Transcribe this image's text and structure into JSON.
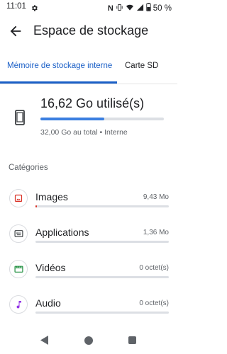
{
  "status_bar": {
    "time": "11:01",
    "battery_percent": "50 %",
    "nfc_letter": "N",
    "icons": [
      "gear-icon",
      "nfc-icon",
      "vibrate-icon",
      "wifi-icon",
      "signal-icon",
      "battery-icon"
    ]
  },
  "header": {
    "title": "Espace de stockage",
    "back_icon": "arrow-back-icon"
  },
  "tabs": [
    {
      "label": "Mémoire de stockage interne",
      "selected": true
    },
    {
      "label": "Carte SD",
      "selected": false
    }
  ],
  "storage": {
    "used_label": "16,62 Go utilisé(s)",
    "total_label": "32,00 Go au total • Interne",
    "used_fraction": 0.52,
    "icon": "phone-icon"
  },
  "categories_heading": "Catégories",
  "categories": [
    {
      "name": "Images",
      "size": "9,43 Mo",
      "icon": "image-icon",
      "color": "#d93025",
      "fraction": 0.01
    },
    {
      "name": "Applications",
      "size": "1,36 Mo",
      "icon": "apps-icon",
      "color": "#3c4043",
      "fraction": 0.0
    },
    {
      "name": "Vidéos",
      "size": "0 octet(s)",
      "icon": "movie-icon",
      "color": "#1e8e3e",
      "fraction": 0.0
    },
    {
      "name": "Audio",
      "size": "0 octet(s)",
      "icon": "music-note-icon",
      "color": "#9334e6",
      "fraction": 0.0
    }
  ],
  "colors": {
    "accent": "#1a5fc7",
    "progress": "#3b7fe0",
    "track": "#dcdfe4"
  },
  "nav_bar": {
    "icons": [
      "nav-back-icon",
      "nav-home-icon",
      "nav-recents-icon"
    ]
  }
}
